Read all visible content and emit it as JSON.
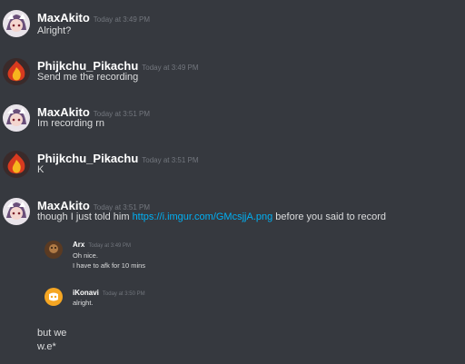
{
  "messages": [
    {
      "user": "MaxAkito",
      "time": "Today at 3:49 PM",
      "text": "Alright?"
    },
    {
      "user": "Phijkchu_Pikachu",
      "time": "Today at 3:49 PM",
      "text": "Send me the recording"
    },
    {
      "user": "MaxAkito",
      "time": "Today at 3:51 PM",
      "text": "Im recording rn"
    },
    {
      "user": "Phijkchu_Pikachu",
      "time": "Today at 3:51 PM",
      "text": "K"
    },
    {
      "user": "MaxAkito",
      "time": "Today at 3:51 PM",
      "text_before": "though I just told him ",
      "link": "https://i.imgur.com/GMcsjjA.png",
      "text_after": " before you said to record"
    }
  ],
  "embedded": [
    {
      "user": "Arx",
      "time": "Today at 3:49 PM",
      "lines": [
        "Oh nice.",
        "I have to afk for 10 mins"
      ]
    },
    {
      "user": "iKonavi",
      "time": "Today at 3:50 PM",
      "lines": [
        "alright."
      ]
    }
  ],
  "followups": [
    "but we",
    "w.e*"
  ],
  "colors": {
    "background": "#36393f",
    "link": "#00b0f4",
    "discord_blurple": "#f5a623"
  },
  "icons": {
    "max_avatar": "anime-avatar-icon",
    "pika_avatar": "flame-avatar-icon",
    "arx_avatar": "brown-avatar-icon",
    "ikonavi_avatar": "discord-logo-icon"
  }
}
